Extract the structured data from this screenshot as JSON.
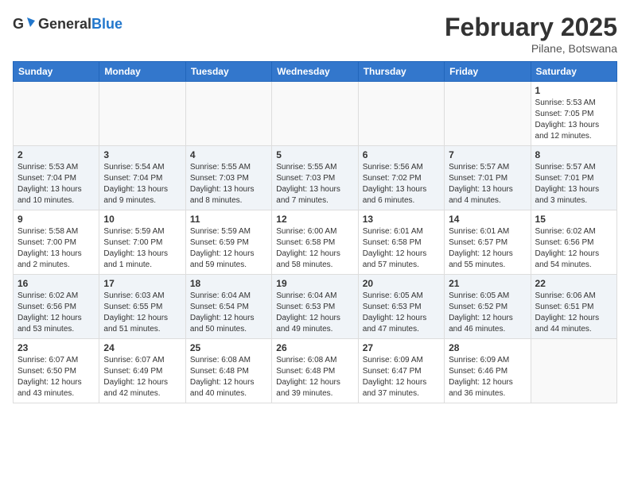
{
  "logo": {
    "general": "General",
    "blue": "Blue"
  },
  "title": "February 2025",
  "location": "Pilane, Botswana",
  "days_of_week": [
    "Sunday",
    "Monday",
    "Tuesday",
    "Wednesday",
    "Thursday",
    "Friday",
    "Saturday"
  ],
  "weeks": [
    [
      {
        "day": "",
        "info": ""
      },
      {
        "day": "",
        "info": ""
      },
      {
        "day": "",
        "info": ""
      },
      {
        "day": "",
        "info": ""
      },
      {
        "day": "",
        "info": ""
      },
      {
        "day": "",
        "info": ""
      },
      {
        "day": "1",
        "info": "Sunrise: 5:53 AM\nSunset: 7:05 PM\nDaylight: 13 hours\nand 12 minutes."
      }
    ],
    [
      {
        "day": "2",
        "info": "Sunrise: 5:53 AM\nSunset: 7:04 PM\nDaylight: 13 hours\nand 10 minutes."
      },
      {
        "day": "3",
        "info": "Sunrise: 5:54 AM\nSunset: 7:04 PM\nDaylight: 13 hours\nand 9 minutes."
      },
      {
        "day": "4",
        "info": "Sunrise: 5:55 AM\nSunset: 7:03 PM\nDaylight: 13 hours\nand 8 minutes."
      },
      {
        "day": "5",
        "info": "Sunrise: 5:55 AM\nSunset: 7:03 PM\nDaylight: 13 hours\nand 7 minutes."
      },
      {
        "day": "6",
        "info": "Sunrise: 5:56 AM\nSunset: 7:02 PM\nDaylight: 13 hours\nand 6 minutes."
      },
      {
        "day": "7",
        "info": "Sunrise: 5:57 AM\nSunset: 7:01 PM\nDaylight: 13 hours\nand 4 minutes."
      },
      {
        "day": "8",
        "info": "Sunrise: 5:57 AM\nSunset: 7:01 PM\nDaylight: 13 hours\nand 3 minutes."
      }
    ],
    [
      {
        "day": "9",
        "info": "Sunrise: 5:58 AM\nSunset: 7:00 PM\nDaylight: 13 hours\nand 2 minutes."
      },
      {
        "day": "10",
        "info": "Sunrise: 5:59 AM\nSunset: 7:00 PM\nDaylight: 13 hours\nand 1 minute."
      },
      {
        "day": "11",
        "info": "Sunrise: 5:59 AM\nSunset: 6:59 PM\nDaylight: 12 hours\nand 59 minutes."
      },
      {
        "day": "12",
        "info": "Sunrise: 6:00 AM\nSunset: 6:58 PM\nDaylight: 12 hours\nand 58 minutes."
      },
      {
        "day": "13",
        "info": "Sunrise: 6:01 AM\nSunset: 6:58 PM\nDaylight: 12 hours\nand 57 minutes."
      },
      {
        "day": "14",
        "info": "Sunrise: 6:01 AM\nSunset: 6:57 PM\nDaylight: 12 hours\nand 55 minutes."
      },
      {
        "day": "15",
        "info": "Sunrise: 6:02 AM\nSunset: 6:56 PM\nDaylight: 12 hours\nand 54 minutes."
      }
    ],
    [
      {
        "day": "16",
        "info": "Sunrise: 6:02 AM\nSunset: 6:56 PM\nDaylight: 12 hours\nand 53 minutes."
      },
      {
        "day": "17",
        "info": "Sunrise: 6:03 AM\nSunset: 6:55 PM\nDaylight: 12 hours\nand 51 minutes."
      },
      {
        "day": "18",
        "info": "Sunrise: 6:04 AM\nSunset: 6:54 PM\nDaylight: 12 hours\nand 50 minutes."
      },
      {
        "day": "19",
        "info": "Sunrise: 6:04 AM\nSunset: 6:53 PM\nDaylight: 12 hours\nand 49 minutes."
      },
      {
        "day": "20",
        "info": "Sunrise: 6:05 AM\nSunset: 6:53 PM\nDaylight: 12 hours\nand 47 minutes."
      },
      {
        "day": "21",
        "info": "Sunrise: 6:05 AM\nSunset: 6:52 PM\nDaylight: 12 hours\nand 46 minutes."
      },
      {
        "day": "22",
        "info": "Sunrise: 6:06 AM\nSunset: 6:51 PM\nDaylight: 12 hours\nand 44 minutes."
      }
    ],
    [
      {
        "day": "23",
        "info": "Sunrise: 6:07 AM\nSunset: 6:50 PM\nDaylight: 12 hours\nand 43 minutes."
      },
      {
        "day": "24",
        "info": "Sunrise: 6:07 AM\nSunset: 6:49 PM\nDaylight: 12 hours\nand 42 minutes."
      },
      {
        "day": "25",
        "info": "Sunrise: 6:08 AM\nSunset: 6:48 PM\nDaylight: 12 hours\nand 40 minutes."
      },
      {
        "day": "26",
        "info": "Sunrise: 6:08 AM\nSunset: 6:48 PM\nDaylight: 12 hours\nand 39 minutes."
      },
      {
        "day": "27",
        "info": "Sunrise: 6:09 AM\nSunset: 6:47 PM\nDaylight: 12 hours\nand 37 minutes."
      },
      {
        "day": "28",
        "info": "Sunrise: 6:09 AM\nSunset: 6:46 PM\nDaylight: 12 hours\nand 36 minutes."
      },
      {
        "day": "",
        "info": ""
      }
    ]
  ]
}
